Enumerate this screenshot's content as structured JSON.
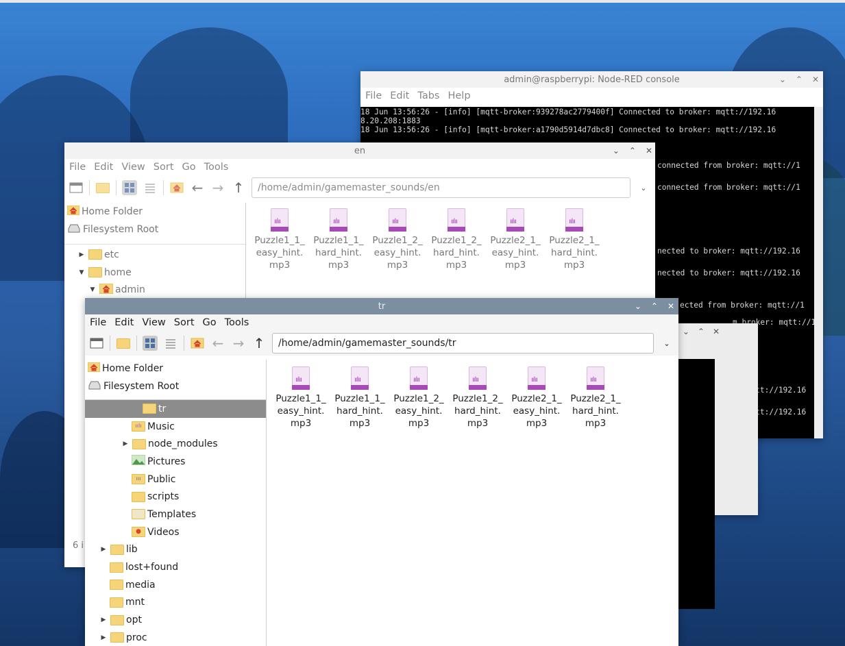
{
  "terminal": {
    "title": "admin@raspberrypi: Node-RED console",
    "menu": [
      "File",
      "Edit",
      "Tabs",
      "Help"
    ],
    "lines": [
      "18 Jun 13:56:26 - [info] [mqtt-broker:939278ac2779400f] Connected to broker: mqtt://192.16",
      "8.20.208:1883",
      "18 Jun 13:56:26 - [info] [mqtt-broker:a1790d5914d7dbc8] Connected to broker: mqtt://192.16"
    ],
    "partial_lines": [
      "connected from broker: mqtt://1",
      "connected from broker: mqtt://1",
      "nected to broker: mqtt://192.16",
      "nected to broker: mqtt://192.16",
      "ected from broker: mqtt://1",
      "m broker: mqtt://1",
      "ker: mqtt://192.16",
      "ker: mqtt://192.16"
    ]
  },
  "en_window": {
    "title": "en",
    "menu": [
      "File",
      "Edit",
      "View",
      "Sort",
      "Go",
      "Tools"
    ],
    "path": "/home/admin/gamemaster_sounds/en",
    "places": [
      "Home Folder",
      "Filesystem Root"
    ],
    "tree": [
      "etc",
      "home",
      "admin"
    ],
    "status": "6 i",
    "files": [
      [
        "Puzzle1_1_",
        "easy_hint.",
        "mp3"
      ],
      [
        "Puzzle1_1_",
        "hard_hint.",
        "mp3"
      ],
      [
        "Puzzle1_2_",
        "easy_hint.",
        "mp3"
      ],
      [
        "Puzzle1_2_",
        "hard_hint.",
        "mp3"
      ],
      [
        "Puzzle2_1_",
        "easy_hint.",
        "mp3"
      ],
      [
        "Puzzle2_1_",
        "hard_hint.",
        "mp3"
      ]
    ]
  },
  "tr_window": {
    "title": "tr",
    "menu": [
      "File",
      "Edit",
      "View",
      "Sort",
      "Go",
      "Tools"
    ],
    "path": "/home/admin/gamemaster_sounds/tr",
    "places": [
      "Home Folder",
      "Filesystem Root"
    ],
    "tree": [
      "tr",
      "Music",
      "node_modules",
      "Pictures",
      "Public",
      "scripts",
      "Templates",
      "Videos",
      "lib",
      "lost+found",
      "media",
      "mnt",
      "opt",
      "proc"
    ],
    "files": [
      [
        "Puzzle1_1_",
        "easy_hint.",
        "mp3"
      ],
      [
        "Puzzle1_1_",
        "hard_hint.",
        "mp3"
      ],
      [
        "Puzzle1_2_",
        "easy_hint.",
        "mp3"
      ],
      [
        "Puzzle1_2_",
        "hard_hint.",
        "mp3"
      ],
      [
        "Puzzle2_1_",
        "easy_hint.",
        "mp3"
      ],
      [
        "Puzzle2_1_",
        "hard_hint.",
        "mp3"
      ]
    ]
  },
  "window_controls": [
    "⌄",
    "⌃",
    "✕"
  ],
  "icons": {
    "home": "home-icon",
    "drive": "drive-icon",
    "folder": "folder-icon",
    "audio": "audio-file-icon"
  },
  "colors": {
    "audio_accent": "#a74ab8",
    "folder": "#f6d57a",
    "active_titlebar": "#7b8fa0"
  }
}
